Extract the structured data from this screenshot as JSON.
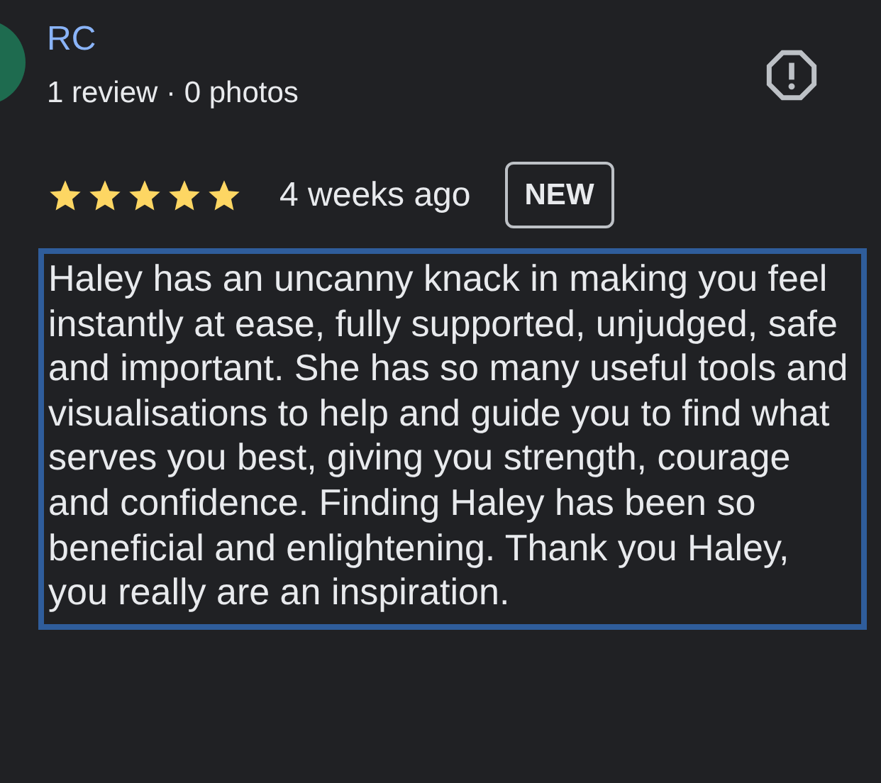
{
  "reviewer": {
    "name": "RC",
    "stats": "1 review · 0 photos"
  },
  "review": {
    "stars": 5,
    "time": "4 weeks ago",
    "badge": "NEW",
    "text": "Haley has an uncanny knack in making you feel instantly at ease, fully supported, unjudged, safe and important. She has so many useful tools and visualisations to help and guide you to find what serves you best, giving you strength, courage and confidence. Finding Haley has been so beneficial and enlightening. Thank you Haley, you really are an inspiration."
  }
}
